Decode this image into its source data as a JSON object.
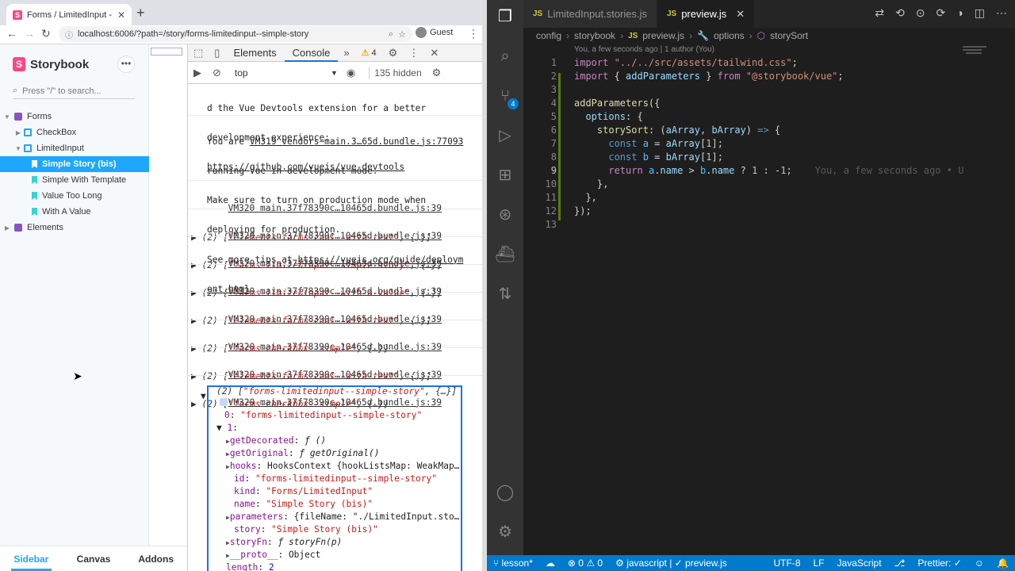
{
  "browser": {
    "tab_title": "Forms / LimitedInput - Simple",
    "url": "localhost:6006/?path=/story/forms-limitedinput--simple-story",
    "profile": "Guest"
  },
  "storybook": {
    "logo": "Storybook",
    "search_placeholder": "Press \"/\" to search...",
    "tree": [
      {
        "label": "Forms",
        "level": 0,
        "kind": "folder"
      },
      {
        "label": "CheckBox",
        "level": 1,
        "kind": "component"
      },
      {
        "label": "LimitedInput",
        "level": 1,
        "kind": "component"
      },
      {
        "label": "Simple Story (bis)",
        "level": 2,
        "kind": "story",
        "selected": true
      },
      {
        "label": "Simple With Template",
        "level": 2,
        "kind": "story"
      },
      {
        "label": "Value Too Long",
        "level": 2,
        "kind": "story"
      },
      {
        "label": "With A Value",
        "level": 2,
        "kind": "story"
      },
      {
        "label": "Elements",
        "level": 0,
        "kind": "folder"
      }
    ],
    "bottom_tabs": [
      "Sidebar",
      "Canvas",
      "Addons"
    ]
  },
  "devtools": {
    "tabs": [
      "Elements",
      "Console"
    ],
    "active_tab": "Console",
    "warnings": "4",
    "context": "top",
    "hidden": "135 hidden",
    "msg_devtools": [
      "d the Vue Devtools extension for a better",
      "development experience:",
      "https://github.com/vuejs/vue-devtools"
    ],
    "msg_prod": {
      "line1_prefix": "You are ",
      "line1_link": "VM319 vendors~main.3…65d.bundle.js:77093",
      "line2": "running Vue in development mode.",
      "line3": "Make sure to turn on production mode when",
      "line4": "deploying for production.",
      "line5_prefix": "See more tips at ",
      "line5_link": "https://vuejs.org/guide/deploym",
      "line6": "ent.html"
    },
    "source": "VM320 main.37f78390c…10465d.bundle.js:39",
    "logs": [
      "elements-forms-cool--with-text",
      "forms-limitedinput--simple-story",
      "forms-limitedinput--with-a-value",
      "elements-forms-cool--with-text",
      "forms-checkbox--simple",
      "elements-forms-cool--with-text",
      "forms-checkbox--simple",
      "forms-limitedinput--simple-story"
    ],
    "expanded": {
      "idx0": "\"forms-limitedinput--simple-story\"",
      "getDecorated": "ƒ ()",
      "getOriginal": "ƒ getOriginal()",
      "hooks": "HooksContext {hookListsMap: WeakMap…",
      "id": "\"forms-limitedinput--simple-story\"",
      "kind": "\"Forms/LimitedInput\"",
      "name": "\"Simple Story (bis)\"",
      "parameters": "{fileName: \"./LimitedInput.sto…",
      "story": "\"Simple Story (bis)\"",
      "storyFn": "ƒ storyFn(p)",
      "proto": "Object",
      "length": "2"
    }
  },
  "vscode": {
    "tabs": [
      {
        "label": "LimitedInput.stories.js",
        "active": false
      },
      {
        "label": "preview.js",
        "active": true
      }
    ],
    "breadcrumbs": [
      "config",
      "storybook",
      "preview.js",
      "options",
      "storySort"
    ],
    "blame": "You, a few seconds ago | 1 author (You)",
    "ghost_blame": "You, a few seconds ago • U",
    "scm_badge": "4",
    "status": {
      "branch": "lesson*",
      "errors": "0",
      "warnings": "0",
      "lang_file": "javascript | ✓ preview.js",
      "encoding": "UTF-8",
      "eol": "LF",
      "language": "JavaScript",
      "prettier": "Prettier: ✓"
    }
  },
  "colors": {
    "storybook_accent": "#1ea7fd",
    "storybook_pink": "#ff4785",
    "vscode_status": "#007acc"
  }
}
